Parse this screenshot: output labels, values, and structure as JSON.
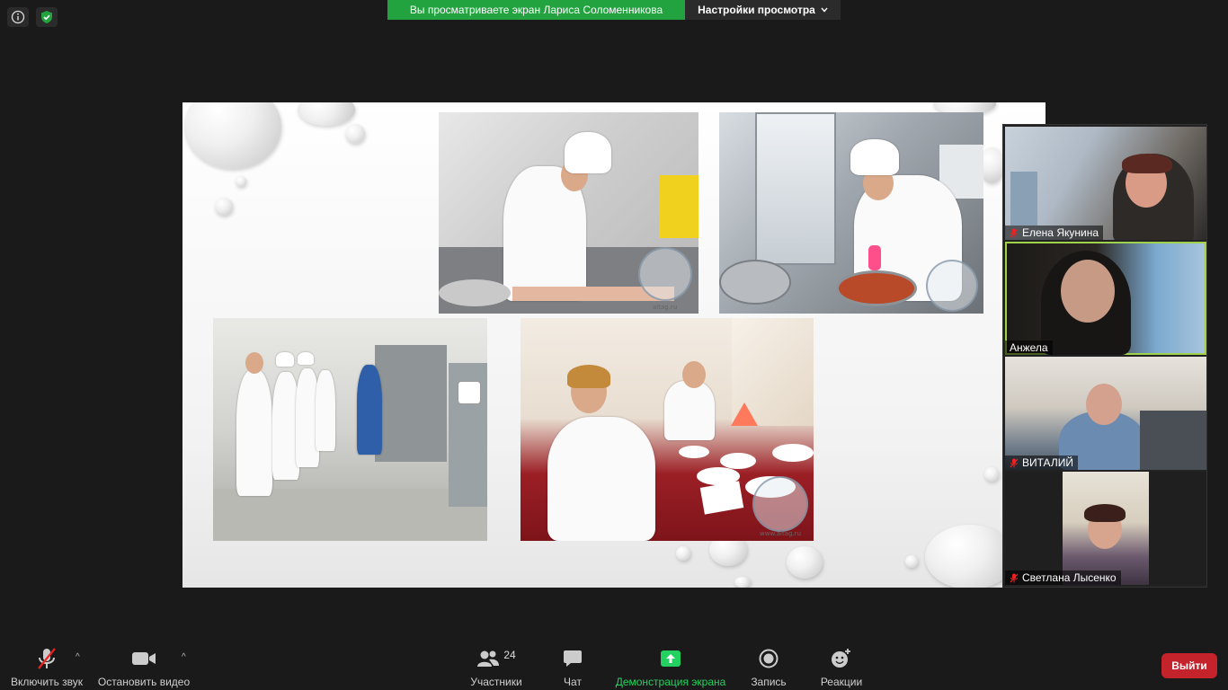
{
  "top_icons": {
    "info": "info-icon",
    "security": "shield-icon"
  },
  "banner": {
    "share_text": "Вы просматриваете экран Лариса Соломенникова",
    "view_options": "Настройки просмотра",
    "accent": "#23a340"
  },
  "slide": {
    "watermark_1": "altag.ru",
    "watermark_2": "www.altag.ru"
  },
  "participants": [
    {
      "name": "Елена Якунина",
      "muted": true
    },
    {
      "name": "Анжела",
      "muted": false
    },
    {
      "name": "ВИТАЛИЙ",
      "muted": true
    },
    {
      "name": "Светлана Лысенко",
      "muted": true
    }
  ],
  "toolbar": {
    "unmute": "Включить звук",
    "stop_video": "Остановить видео",
    "participants_label": "Участники",
    "participants_count": "24",
    "chat": "Чат",
    "share": "Демонстрация экрана",
    "record": "Запись",
    "reactions": "Реакции",
    "leave": "Выйти",
    "share_color": "#23d160",
    "leave_color": "#c4232b"
  }
}
